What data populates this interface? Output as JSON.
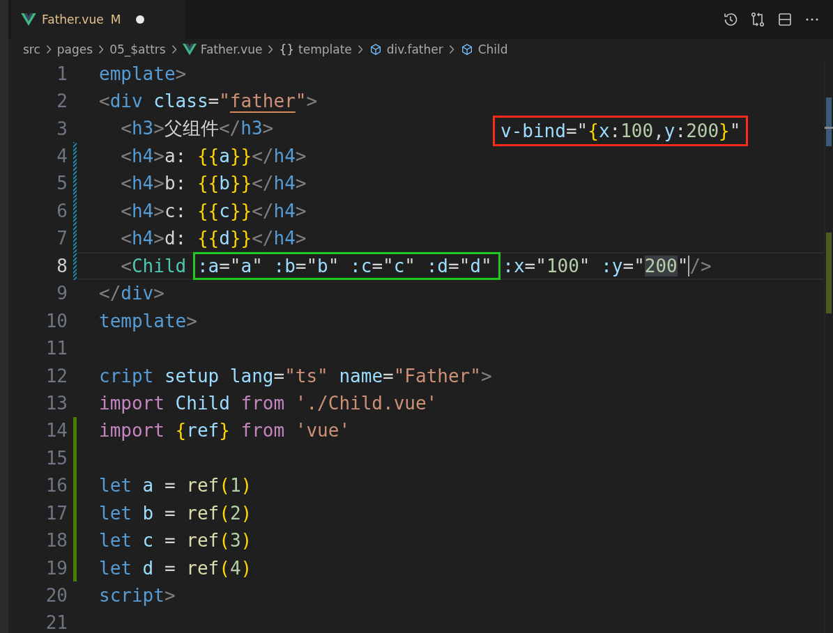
{
  "tab": {
    "label": "Father.vue",
    "status": "M",
    "unsaved": true,
    "selected": true
  },
  "breadcrumb": [
    {
      "label": "src",
      "kind": "folder"
    },
    {
      "label": "pages",
      "kind": "folder"
    },
    {
      "label": "05_$attrs",
      "kind": "folder"
    },
    {
      "label": "Father.vue",
      "kind": "vue-file"
    },
    {
      "label": "template",
      "kind": "symbol",
      "glyph": "{}"
    },
    {
      "label": "div.father",
      "kind": "element"
    },
    {
      "label": "Child",
      "kind": "element"
    }
  ],
  "lines": [
    {
      "number": "1",
      "modified": false,
      "added": false,
      "current": false,
      "tokens": [
        {
          "text": "emplate",
          "kind": "tag"
        },
        {
          "text": ">",
          "kind": "punct"
        }
      ]
    },
    {
      "number": "2",
      "modified": false,
      "added": false,
      "current": false,
      "tokens": [
        {
          "text": "<",
          "kind": "punct"
        },
        {
          "text": "div",
          "kind": "tag"
        },
        {
          "text": " class",
          "kind": "attr"
        },
        {
          "text": "=",
          "kind": "plain"
        },
        {
          "text": "\"",
          "kind": "string"
        },
        {
          "text": "father",
          "kind": "string",
          "underlined": true
        },
        {
          "text": "\"",
          "kind": "string"
        },
        {
          "text": ">",
          "kind": "punct"
        }
      ]
    },
    {
      "number": "3",
      "modified": false,
      "added": false,
      "current": false,
      "tokens": [
        {
          "text": "  <",
          "kind": "punct"
        },
        {
          "text": "h3",
          "kind": "tag"
        },
        {
          "text": ">",
          "kind": "punct"
        },
        {
          "text": "父组件",
          "kind": "plain"
        },
        {
          "text": "</",
          "kind": "punct"
        },
        {
          "text": "h3",
          "kind": "tag"
        },
        {
          "text": ">",
          "kind": "punct"
        }
      ]
    },
    {
      "number": "4",
      "modified": true,
      "added": false,
      "current": false,
      "tokens": [
        {
          "text": "  <",
          "kind": "punct"
        },
        {
          "text": "h4",
          "kind": "tag"
        },
        {
          "text": ">",
          "kind": "punct"
        },
        {
          "text": "a: ",
          "kind": "plain"
        },
        {
          "text": "{{",
          "kind": "brace"
        },
        {
          "text": "a",
          "kind": "var"
        },
        {
          "text": "}}",
          "kind": "brace"
        },
        {
          "text": "</",
          "kind": "punct"
        },
        {
          "text": "h4",
          "kind": "tag"
        },
        {
          "text": ">",
          "kind": "punct"
        }
      ]
    },
    {
      "number": "5",
      "modified": true,
      "added": false,
      "current": false,
      "tokens": [
        {
          "text": "  <",
          "kind": "punct"
        },
        {
          "text": "h4",
          "kind": "tag"
        },
        {
          "text": ">",
          "kind": "punct"
        },
        {
          "text": "b: ",
          "kind": "plain"
        },
        {
          "text": "{{",
          "kind": "brace"
        },
        {
          "text": "b",
          "kind": "var"
        },
        {
          "text": "}}",
          "kind": "brace"
        },
        {
          "text": "</",
          "kind": "punct"
        },
        {
          "text": "h4",
          "kind": "tag"
        },
        {
          "text": ">",
          "kind": "punct"
        }
      ]
    },
    {
      "number": "6",
      "modified": true,
      "added": false,
      "current": false,
      "tokens": [
        {
          "text": "  <",
          "kind": "punct"
        },
        {
          "text": "h4",
          "kind": "tag"
        },
        {
          "text": ">",
          "kind": "punct"
        },
        {
          "text": "c: ",
          "kind": "plain"
        },
        {
          "text": "{{",
          "kind": "brace"
        },
        {
          "text": "c",
          "kind": "var"
        },
        {
          "text": "}}",
          "kind": "brace"
        },
        {
          "text": "</",
          "kind": "punct"
        },
        {
          "text": "h4",
          "kind": "tag"
        },
        {
          "text": ">",
          "kind": "punct"
        }
      ]
    },
    {
      "number": "7",
      "modified": true,
      "added": false,
      "current": false,
      "tokens": [
        {
          "text": "  <",
          "kind": "punct"
        },
        {
          "text": "h4",
          "kind": "tag"
        },
        {
          "text": ">",
          "kind": "punct"
        },
        {
          "text": "d: ",
          "kind": "plain"
        },
        {
          "text": "{{",
          "kind": "brace"
        },
        {
          "text": "d",
          "kind": "var"
        },
        {
          "text": "}}",
          "kind": "brace"
        },
        {
          "text": "</",
          "kind": "punct"
        },
        {
          "text": "h4",
          "kind": "tag"
        },
        {
          "text": ">",
          "kind": "punct"
        }
      ]
    },
    {
      "number": "8",
      "modified": true,
      "added": false,
      "current": true,
      "segments": [
        {
          "kind": "code",
          "tokens": [
            {
              "text": "  <",
              "kind": "punct"
            },
            {
              "text": "Child ",
              "kind": "component"
            }
          ]
        },
        {
          "kind": "frame",
          "tokens": [
            {
              "text": ":a",
              "kind": "attr"
            },
            {
              "text": "=\"",
              "kind": "plain"
            },
            {
              "text": "a",
              "kind": "var"
            },
            {
              "text": "\" ",
              "kind": "plain"
            },
            {
              "text": ":b",
              "kind": "attr"
            },
            {
              "text": "=\"",
              "kind": "plain"
            },
            {
              "text": "b",
              "kind": "var"
            },
            {
              "text": "\" ",
              "kind": "plain"
            },
            {
              "text": ":c",
              "kind": "attr"
            },
            {
              "text": "=\"",
              "kind": "plain"
            },
            {
              "text": "c",
              "kind": "var"
            },
            {
              "text": "\" ",
              "kind": "plain"
            },
            {
              "text": ":d",
              "kind": "attr"
            },
            {
              "text": "=\"",
              "kind": "plain"
            },
            {
              "text": "d",
              "kind": "var"
            },
            {
              "text": "\"",
              "kind": "plain"
            }
          ]
        },
        {
          "kind": "code",
          "tokens": [
            {
              "text": " :x",
              "kind": "attr"
            },
            {
              "text": "=\"",
              "kind": "plain"
            },
            {
              "text": "100",
              "kind": "number"
            },
            {
              "text": "\" ",
              "kind": "plain"
            },
            {
              "text": ":y",
              "kind": "attr"
            },
            {
              "text": "=\"",
              "kind": "plain"
            },
            {
              "text": "200",
              "kind": "number",
              "highlighted": true
            },
            {
              "text": "\"",
              "kind": "plain",
              "cursor": true
            },
            {
              "text": "/>",
              "kind": "punct"
            }
          ]
        }
      ]
    },
    {
      "number": "9",
      "modified": false,
      "added": false,
      "current": false,
      "tokens": [
        {
          "text": "</",
          "kind": "punct"
        },
        {
          "text": "div",
          "kind": "tag"
        },
        {
          "text": ">",
          "kind": "punct"
        }
      ]
    },
    {
      "number": "10",
      "modified": false,
      "added": false,
      "current": false,
      "tokens": [
        {
          "text": "template",
          "kind": "tag"
        },
        {
          "text": ">",
          "kind": "punct"
        }
      ]
    },
    {
      "number": "11",
      "modified": false,
      "added": false,
      "current": false
    },
    {
      "number": "12",
      "modified": false,
      "added": false,
      "current": false,
      "tokens": [
        {
          "text": "cript",
          "kind": "tag"
        },
        {
          "text": " setup",
          "kind": "attr"
        },
        {
          "text": " lang",
          "kind": "attr"
        },
        {
          "text": "=",
          "kind": "plain"
        },
        {
          "text": "\"ts\"",
          "kind": "string"
        },
        {
          "text": " name",
          "kind": "attr"
        },
        {
          "text": "=",
          "kind": "plain"
        },
        {
          "text": "\"Father\"",
          "kind": "string"
        },
        {
          "text": ">",
          "kind": "punct"
        }
      ]
    },
    {
      "number": "13",
      "modified": false,
      "added": false,
      "current": false,
      "tokens": [
        {
          "text": "import",
          "kind": "keyword"
        },
        {
          "text": " Child",
          "kind": "var"
        },
        {
          "text": " from",
          "kind": "keyword"
        },
        {
          "text": " './Child.vue'",
          "kind": "string"
        }
      ]
    },
    {
      "number": "14",
      "modified": false,
      "added": true,
      "current": false,
      "tokens": [
        {
          "text": "import",
          "kind": "keyword"
        },
        {
          "text": " {",
          "kind": "brace"
        },
        {
          "text": "ref",
          "kind": "var"
        },
        {
          "text": "}",
          "kind": "brace"
        },
        {
          "text": " from",
          "kind": "keyword"
        },
        {
          "text": " 'vue'",
          "kind": "string"
        }
      ]
    },
    {
      "number": "15",
      "modified": false,
      "added": true,
      "current": false
    },
    {
      "number": "16",
      "modified": false,
      "added": true,
      "current": false,
      "tokens": [
        {
          "text": "let",
          "kind": "storage"
        },
        {
          "text": " a",
          "kind": "var"
        },
        {
          "text": " = ",
          "kind": "plain"
        },
        {
          "text": "ref",
          "kind": "func"
        },
        {
          "text": "(",
          "kind": "brace"
        },
        {
          "text": "1",
          "kind": "number"
        },
        {
          "text": ")",
          "kind": "brace"
        }
      ]
    },
    {
      "number": "17",
      "modified": false,
      "added": true,
      "current": false,
      "tokens": [
        {
          "text": "let",
          "kind": "storage"
        },
        {
          "text": " b",
          "kind": "var"
        },
        {
          "text": " = ",
          "kind": "plain"
        },
        {
          "text": "ref",
          "kind": "func"
        },
        {
          "text": "(",
          "kind": "brace"
        },
        {
          "text": "2",
          "kind": "number"
        },
        {
          "text": ")",
          "kind": "brace"
        }
      ]
    },
    {
      "number": "18",
      "modified": false,
      "added": true,
      "current": false,
      "tokens": [
        {
          "text": "let",
          "kind": "storage"
        },
        {
          "text": " c",
          "kind": "var"
        },
        {
          "text": " = ",
          "kind": "plain"
        },
        {
          "text": "ref",
          "kind": "func"
        },
        {
          "text": "(",
          "kind": "brace"
        },
        {
          "text": "3",
          "kind": "number"
        },
        {
          "text": ")",
          "kind": "brace"
        }
      ]
    },
    {
      "number": "19",
      "modified": false,
      "added": true,
      "current": false,
      "tokens": [
        {
          "text": "let",
          "kind": "storage"
        },
        {
          "text": " d",
          "kind": "var"
        },
        {
          "text": " = ",
          "kind": "plain"
        },
        {
          "text": "ref",
          "kind": "func"
        },
        {
          "text": "(",
          "kind": "brace"
        },
        {
          "text": "4",
          "kind": "number"
        },
        {
          "text": ")",
          "kind": "brace"
        }
      ]
    },
    {
      "number": "20",
      "modified": false,
      "added": false,
      "current": false,
      "tokens": [
        {
          "text": "script",
          "kind": "tag"
        },
        {
          "text": ">",
          "kind": "punct"
        }
      ]
    },
    {
      "number": "21",
      "modified": false,
      "added": false,
      "current": false
    }
  ],
  "annotation": {
    "kind": "callout",
    "tokens": [
      {
        "text": "v-bind",
        "kind": "attr"
      },
      {
        "text": "=\"",
        "kind": "plain"
      },
      {
        "text": "{",
        "kind": "brace"
      },
      {
        "text": "x",
        "kind": "var"
      },
      {
        "text": ":",
        "kind": "plain"
      },
      {
        "text": "100",
        "kind": "number"
      },
      {
        "text": ",",
        "kind": "plain"
      },
      {
        "text": "y",
        "kind": "var"
      },
      {
        "text": ":",
        "kind": "plain"
      },
      {
        "text": "200",
        "kind": "number"
      },
      {
        "text": "}",
        "kind": "brace"
      },
      {
        "text": "\"",
        "kind": "plain"
      }
    ]
  }
}
